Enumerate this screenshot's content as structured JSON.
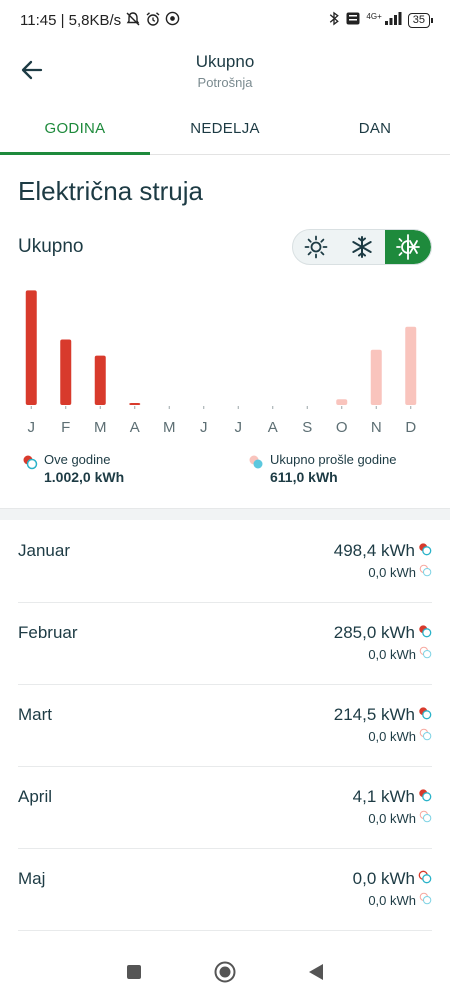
{
  "status_bar": {
    "time_speed": "11:45 | 5,8KB/s",
    "network": "4G+",
    "battery": "35"
  },
  "header": {
    "title": "Ukupno",
    "subtitle": "Potrošnja"
  },
  "tabs": [
    {
      "label": "GODINA",
      "active": true
    },
    {
      "label": "NEDELJA",
      "active": false
    },
    {
      "label": "DAN",
      "active": false
    }
  ],
  "section_title": "Električna struja",
  "subsection_title": "Ukupno",
  "season_toggle": {
    "options": [
      "sun-icon",
      "snowflake-icon",
      "sun-snowflake-icon"
    ],
    "selected": "sun-snowflake-icon",
    "accent": "#1e8a3c"
  },
  "chart_data": {
    "type": "bar",
    "categories": [
      "J",
      "F",
      "M",
      "A",
      "M",
      "J",
      "J",
      "A",
      "S",
      "O",
      "N",
      "D"
    ],
    "series": [
      {
        "name": "Ove godine",
        "color": "#d83a2c",
        "values": [
          498.4,
          285.0,
          214.5,
          4.1,
          0,
          0,
          0,
          0,
          0,
          0,
          0,
          0
        ]
      },
      {
        "name": "Ukupno prošle godine",
        "color": "#f9c4bd",
        "values": [
          0,
          0,
          0,
          0,
          0,
          0,
          0,
          0,
          0,
          25,
          240,
          340
        ]
      }
    ],
    "ylim": [
      0,
      500
    ]
  },
  "legend": {
    "current": {
      "label": "Ove godine",
      "value": "1.002,0 kWh"
    },
    "previous": {
      "label": "Ukupno prošle godine",
      "value": "611,0 kWh"
    }
  },
  "months": [
    {
      "name": "Januar",
      "current": "498,4 kWh",
      "previous": "0,0 kWh"
    },
    {
      "name": "Februar",
      "current": "285,0 kWh",
      "previous": "0,0 kWh"
    },
    {
      "name": "Mart",
      "current": "214,5 kWh",
      "previous": "0,0 kWh"
    },
    {
      "name": "April",
      "current": "4,1 kWh",
      "previous": "0,0 kWh"
    },
    {
      "name": "Maj",
      "current": "0,0 kWh",
      "previous": "0,0 kWh"
    }
  ],
  "colors": {
    "current_bar": "#d83a2c",
    "previous_bar": "#f9c4bd",
    "teal": "#2bb3c9",
    "accent": "#1e8a3c"
  }
}
